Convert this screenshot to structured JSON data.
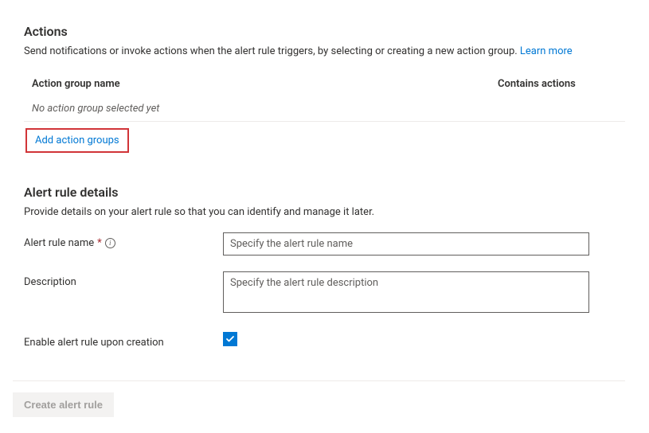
{
  "actions": {
    "title": "Actions",
    "description_pre": "Send notifications or invoke actions when the alert rule triggers, by selecting or creating a new action group. ",
    "learn_more": "Learn more",
    "table": {
      "col_name": "Action group name",
      "col_contains": "Contains actions",
      "empty_text": "No action group selected yet"
    },
    "add_link": "Add action groups"
  },
  "details": {
    "title": "Alert rule details",
    "description": "Provide details on your alert rule so that you can identify and manage it later.",
    "name_label": "Alert rule name",
    "name_placeholder": "Specify the alert rule name",
    "desc_label": "Description",
    "desc_placeholder": "Specify the alert rule description",
    "enable_label": "Enable alert rule upon creation"
  },
  "footer": {
    "create_label": "Create alert rule"
  }
}
